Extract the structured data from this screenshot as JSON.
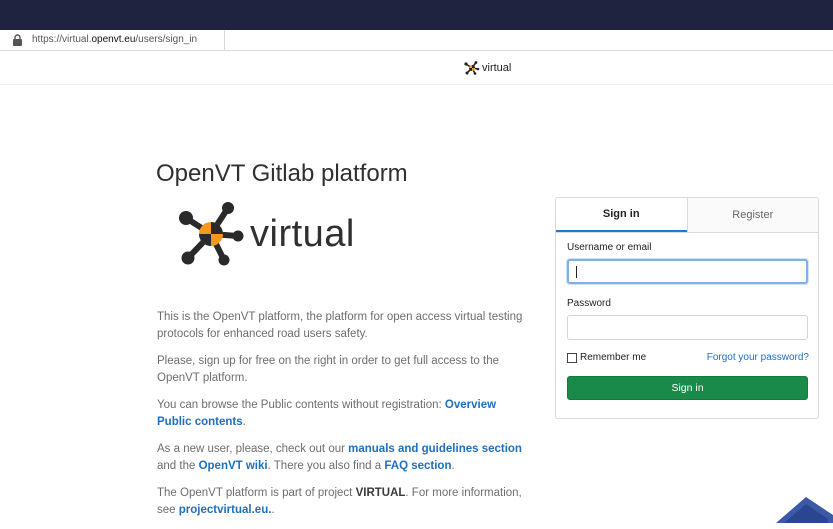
{
  "browser": {
    "url_prefix": "https://virtual.",
    "url_domain": "openvt.eu",
    "url_path": "/users/sign_in"
  },
  "header": {
    "brand_text": "virtual"
  },
  "main": {
    "title": "OpenVT Gitlab platform",
    "logo_word": "virtual",
    "paragraphs": {
      "p1": "This is the OpenVT platform, the platform for open access virtual testing protocols for enhanced road users safety.",
      "p2": "Please, sign up for free on the right in order to get full access to the OpenVT platform.",
      "p3_text": "You can browse the Public contents without registration: ",
      "p3_link": "Overview Public contents",
      "p3_end": ".",
      "p4_text1": "As a new user, please, check out our ",
      "p4_link1": "manuals and guidelines section",
      "p4_text2": " and the ",
      "p4_link2": "OpenVT wiki",
      "p4_text3": ". There you also find a ",
      "p4_link3": "FAQ section",
      "p4_end": ".",
      "p5_text1": "The OpenVT platform is part of project ",
      "p5_strong": "VIRTUAL",
      "p5_text2": ". For more information, see ",
      "p5_link": "projectvirtual.eu.",
      "p5_end": "."
    }
  },
  "login": {
    "tab_signin": "Sign in",
    "tab_register": "Register",
    "username_label": "Username or email",
    "username_value": "",
    "password_label": "Password",
    "password_value": "",
    "remember_label": "Remember me",
    "forgot_link": "Forgot your password?",
    "signin_button": "Sign in"
  },
  "colors": {
    "titlebar": "#1f2340",
    "link": "#1f6fbf",
    "primary_button": "#1a8a4a",
    "active_tab_border": "#1f78d1"
  }
}
